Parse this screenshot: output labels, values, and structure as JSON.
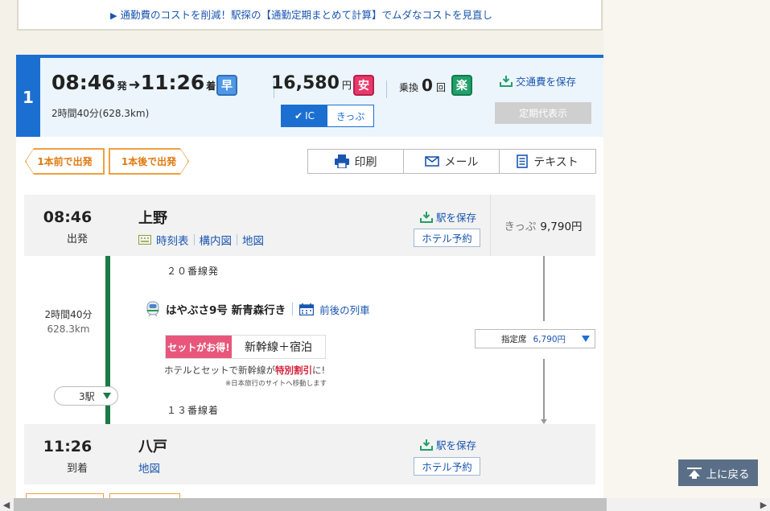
{
  "notice": {
    "text": "通勤費のコストを削減！駅探の【通勤定期まとめて計算】でムダなコストを見直し"
  },
  "route": {
    "number": "1",
    "depart_time": "08:46",
    "depart_suffix": "発",
    "arrive_time": "11:26",
    "arrive_suffix": "着",
    "duration": "2時間40分(628.3km)",
    "fare": "16,580",
    "fare_unit": "円",
    "transfers_label": "乗換",
    "transfers_count": "0",
    "transfers_unit": "回",
    "badge_fast": "早",
    "badge_cheap": "安",
    "badge_easy": "楽",
    "fare_ic": "IC",
    "fare_ticket": "きっぷ",
    "save_fare": "交通費を保存",
    "teiki": "定期代表示"
  },
  "toolbar": {
    "prev": "1本前で出発",
    "next": "1本後で出発",
    "print": "印刷",
    "mail": "メール",
    "text": "テキスト"
  },
  "departure": {
    "time": "08:46",
    "label": "出発",
    "name": "上野",
    "links": [
      "時刻表",
      "構内図",
      "地図"
    ],
    "save": "駅を保存",
    "hotel": "ホテル予約",
    "fare_label": "きっぷ",
    "fare_value": "9,790円"
  },
  "segment": {
    "duration": "2時間40分",
    "distance": "628.3km",
    "platform_dep": "２０番線発",
    "train": "はやぶさ9号 新青森行き",
    "train_link": "前後の列車",
    "promo_tag": "セットがお得!",
    "promo_text": "新幹線＋宿泊",
    "promo_desc_a": "ホテルとセットで新幹線が",
    "promo_desc_hl": "特別割引",
    "promo_desc_b": "に!",
    "promo_note": "※日本旅行のサイトへ移動します",
    "stops": "3駅",
    "platform_arr": "１３番線着",
    "seat_label": "指定席",
    "seat_value": "6,790円"
  },
  "arrival": {
    "time": "11:26",
    "label": "到着",
    "name": "八戸",
    "links": [
      "地図"
    ],
    "save": "駅を保存",
    "hotel": "ホテル予約"
  },
  "back_to_top": "上に戻る",
  "colors": {
    "accent": "#1b6fd1",
    "line_green": "#1b7a46",
    "orange": "#f0a040"
  }
}
